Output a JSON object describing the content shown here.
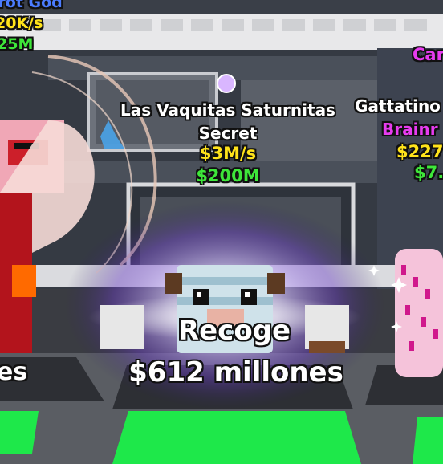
{
  "labels": {
    "topleft": {
      "name": "rrot God",
      "rate": "20K/s",
      "cost": "25M"
    },
    "center": {
      "name": "Las Vaquitas Saturnitas",
      "rarity": "Secret",
      "rate": "$3M/s",
      "cost": "$200M"
    },
    "right": {
      "top": "Car",
      "name": "Gattatino",
      "rarity": "Brainr",
      "rate": "$227",
      "cost": "$7."
    }
  },
  "collect": {
    "label": "Recoge",
    "amount": "$612 millones",
    "left_partial": "es"
  },
  "colors": {
    "yellow": "#ffe31a",
    "green": "#3ee63a",
    "magenta": "#e83cf0",
    "floor_tile": "#1ee84a"
  }
}
